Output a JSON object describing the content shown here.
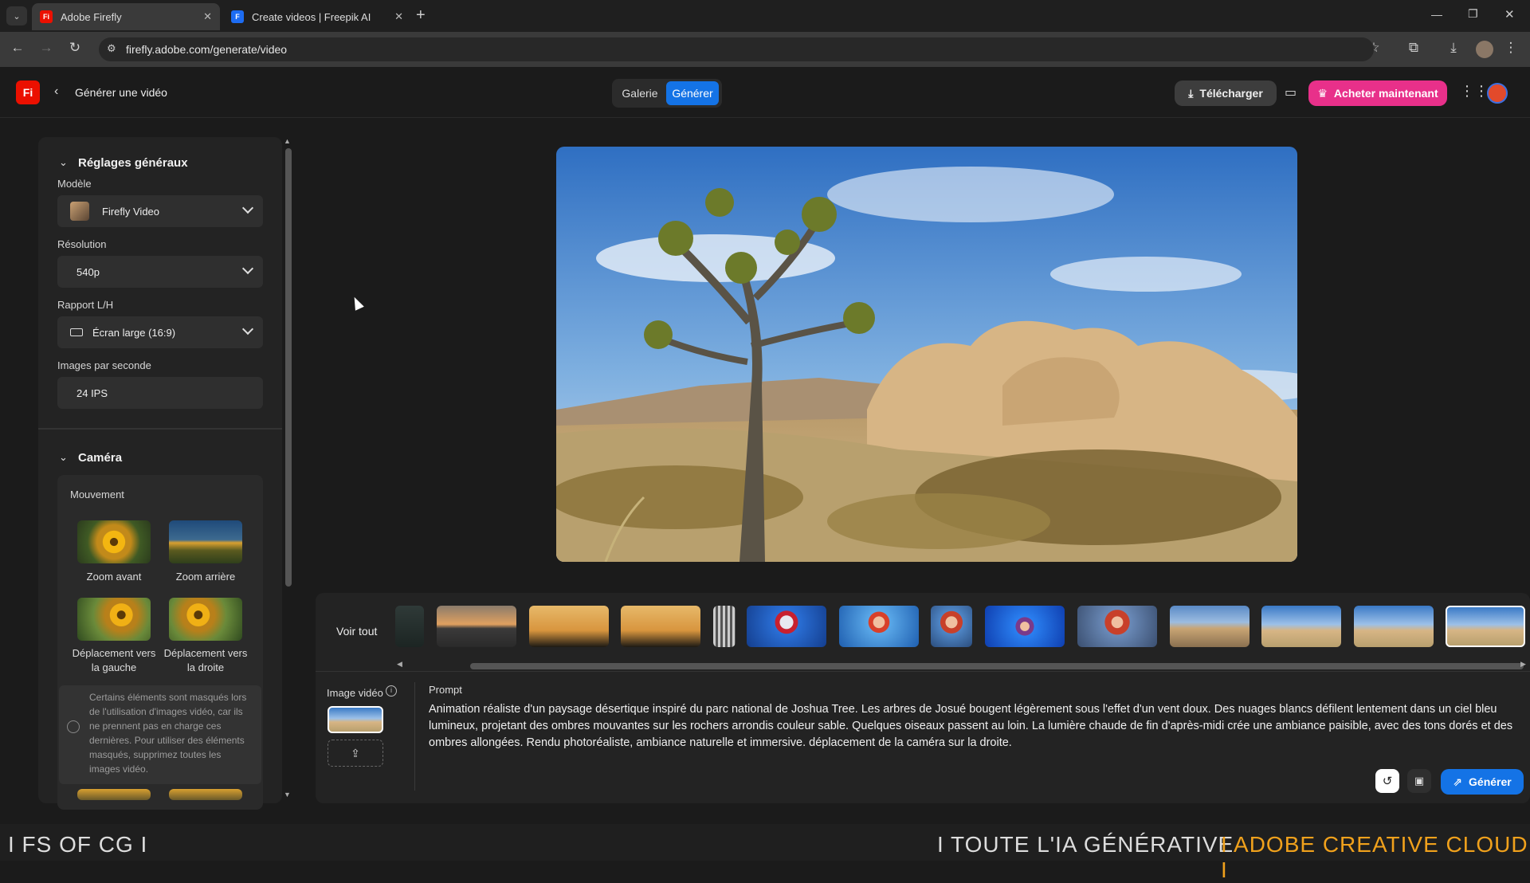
{
  "browser": {
    "tabs": [
      {
        "title": "Adobe Firefly",
        "favicon": "Fi"
      },
      {
        "title": "Create videos | Freepik AI",
        "favicon": "F"
      }
    ],
    "url": "firefly.adobe.com/generate/video"
  },
  "header": {
    "logo": "Fi",
    "back_title": "Générer une vidéo",
    "tabs": [
      "Galerie",
      "Générer"
    ],
    "download_label": "Télécharger",
    "buy_label": "Acheter maintenant"
  },
  "settings": {
    "general_title": "Réglages généraux",
    "model_label": "Modèle",
    "model_value": "Firefly Video",
    "resolution_label": "Résolution",
    "resolution_value": "540p",
    "aspect_label": "Rapport L/H",
    "aspect_value": "Écran large (16:9)",
    "fps_label": "Images par seconde",
    "fps_value": "24 IPS",
    "camera_title": "Caméra",
    "movement_label": "Mouvement",
    "movements": [
      "Zoom avant",
      "Zoom arrière",
      "Déplacement vers la gauche",
      "Déplacement vers la droite"
    ],
    "note": "Certains éléments sont masqués lors de l'utilisation d'images vidéo, car ils ne prennent pas en charge ces dernières. Pour utiliser des éléments masqués, supprimez toutes les images vidéo."
  },
  "gallery": {
    "see_all": "Voir tout"
  },
  "prompt": {
    "image_label": "Image vidéo",
    "label": "Prompt",
    "text": "Animation réaliste d'un paysage désertique inspiré du parc national de Joshua Tree. Les arbres de Josué bougent légèrement sous l'effet d'un vent doux. Des nuages blancs défilent lentement dans un ciel bleu lumineux, projetant des ombres mouvantes sur les rochers arrondis couleur sable. Quelques oiseaux passent au loin. La lumière chaude de fin d'après-midi crée une ambiance paisible, avec des tons dorés et des ombres allongées. Rendu photoréaliste, ambiance naturelle et immersive. déplacement de la caméra sur la droite.",
    "generate_label": "Générer"
  },
  "footer": {
    "left": "I FS OF CG I",
    "right_a": "I TOUTE L'IA GÉNÉRATIVE",
    "right_b": "I ADOBE CREATIVE CLOUD I"
  },
  "colors": {
    "accent": "#1473e6",
    "buy": "#e8308a",
    "brand": "#eb1000",
    "footer_gold": "#f0a11c"
  }
}
